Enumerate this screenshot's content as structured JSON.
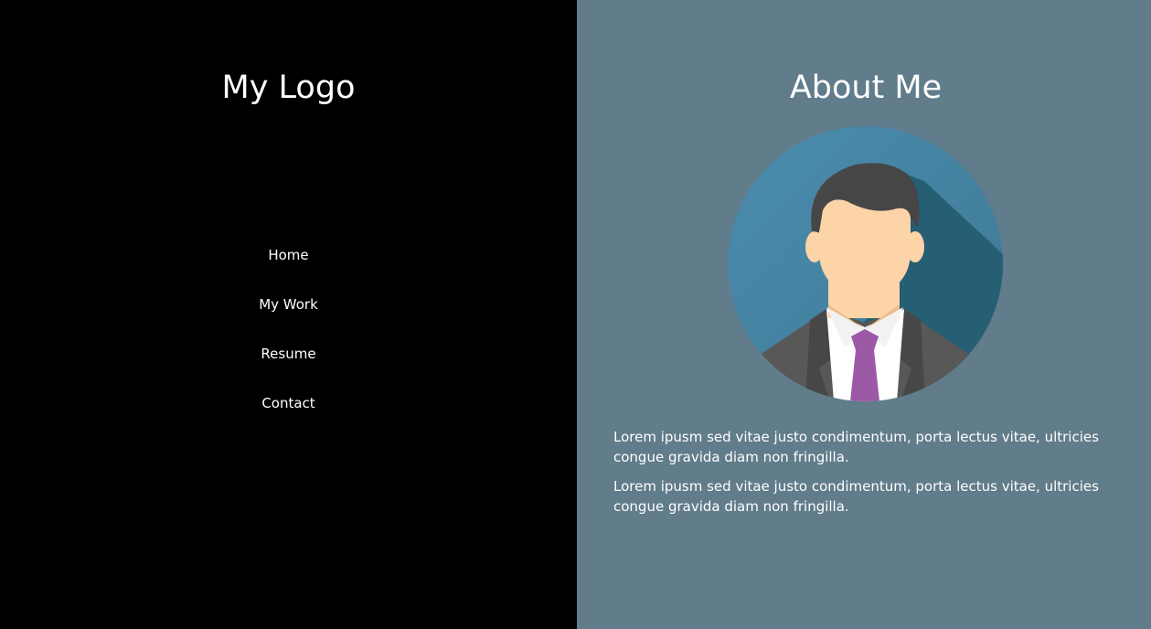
{
  "sidebar": {
    "logo": "My Logo",
    "nav": [
      {
        "label": "Home"
      },
      {
        "label": "My Work"
      },
      {
        "label": "Resume"
      },
      {
        "label": "Contact"
      }
    ]
  },
  "main": {
    "title": "About Me",
    "paragraphs": [
      "Lorem ipusm sed vitae justo condimentum, porta lectus vitae, ultricies congue gravida diam non fringilla.",
      "Lorem ipusm sed vitae justo condimentum, porta lectus vitae, ultricies congue gravida diam non fringilla."
    ]
  },
  "colors": {
    "sidebar_bg": "#000000",
    "main_bg": "#617c8a",
    "avatar_circle": "#4a87a8",
    "avatar_shadow": "#265f74",
    "skin": "#fdd3a8",
    "hair": "#464646",
    "suit": "#555555",
    "tie": "#9b59a6"
  },
  "icons": {
    "avatar": "businessman-avatar-icon"
  }
}
